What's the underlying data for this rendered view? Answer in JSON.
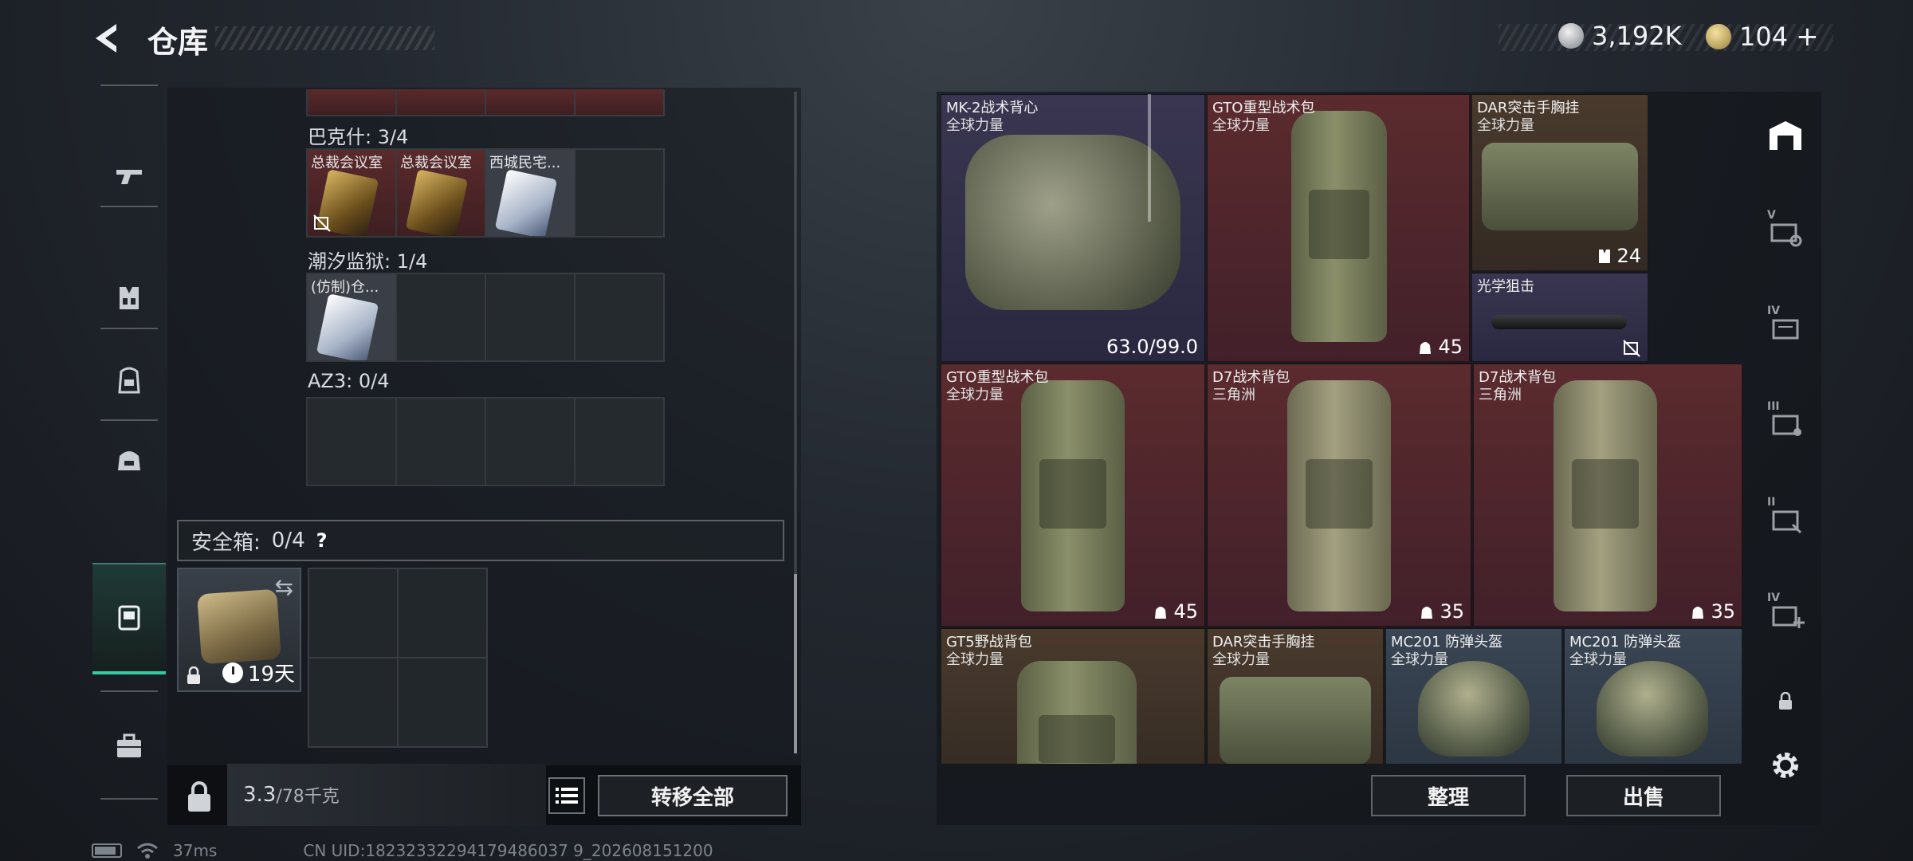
{
  "header": {
    "title": "仓库",
    "currency_silver": "3,192K",
    "currency_gold": "104",
    "plus": "+"
  },
  "nav": {
    "items": [
      "pistol-icon",
      "vest-icon",
      "backpack-icon",
      "bag-icon",
      "safe-case-icon",
      "briefcase-icon"
    ],
    "active_index": 4
  },
  "keys": {
    "bakesh_label": "巴克什: 3/4",
    "bakesh_items": [
      {
        "name": "总裁会议室",
        "style": "gold",
        "no_sell": true
      },
      {
        "name": "总裁会议室",
        "style": "gold",
        "no_sell": false
      },
      {
        "name": "西城民宅...",
        "style": "white",
        "no_sell": false
      },
      {
        "name": "",
        "style": "empty",
        "no_sell": false
      }
    ],
    "prison_label": "潮汐监狱: 1/4",
    "prison_items": [
      {
        "name": "(仿制)仓...",
        "style": "white"
      }
    ],
    "az3_label": "AZ3: 0/4"
  },
  "safe": {
    "label": "安全箱:",
    "count": "0/4",
    "help": "?",
    "days": "19天"
  },
  "footer_left": {
    "weight": "3.3",
    "weight_cap": "/78千克",
    "transfer_all": "转移全部"
  },
  "items": [
    {
      "name": "MK-2战术背心",
      "sub": "全球力量",
      "value": "63.0/99.0",
      "rarity": "purple"
    },
    {
      "name": "GTO重型战术包",
      "sub": "全球力量",
      "value": "45",
      "rarity": "red"
    },
    {
      "name": "DAR突击手胸挂",
      "sub": "全球力量",
      "value": "24",
      "rarity": "brown"
    },
    {
      "name": "光学狙击",
      "sub": "",
      "value": "",
      "rarity": "purple"
    },
    {
      "name": "GTO重型战术包",
      "sub": "全球力量",
      "value": "45",
      "rarity": "red"
    },
    {
      "name": "D7战术背包",
      "sub": "三角洲",
      "value": "35",
      "rarity": "red"
    },
    {
      "name": "D7战术背包",
      "sub": "三角洲",
      "value": "35",
      "rarity": "red"
    },
    {
      "name": "GT5野战背包",
      "sub": "全球力量",
      "value": "",
      "rarity": "brown"
    },
    {
      "name": "DAR突击手胸挂",
      "sub": "全球力量",
      "value": "",
      "rarity": "brown"
    },
    {
      "name": "MC201 防弹头盔",
      "sub": "全球力量",
      "value": "",
      "rarity": "blue"
    },
    {
      "name": "MC201 防弹头盔",
      "sub": "全球力量",
      "value": "",
      "rarity": "blue"
    }
  ],
  "footer_right": {
    "sort": "整理",
    "sell": "出售"
  },
  "right_nav": {
    "labels": [
      "V",
      "IV",
      "III",
      "II",
      "IV"
    ]
  },
  "status_bar": {
    "ping": "37ms",
    "uid": "CN UID:18232332294179486037 9_202608151200"
  }
}
